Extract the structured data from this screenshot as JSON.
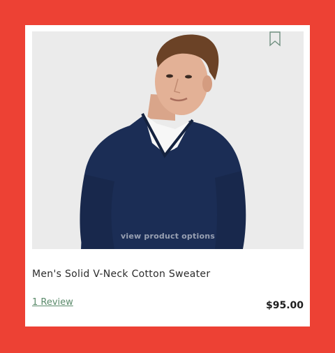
{
  "product": {
    "title": "Men's Solid V-Neck Cotton Sweater",
    "price": "$95.00",
    "review_link": "1 Review",
    "overlay_text": "view product options"
  },
  "icons": {
    "bookmark": "bookmark-icon"
  },
  "colors": {
    "page_background": "#ed4134",
    "card_background": "#ffffff",
    "image_background": "#ebebeb",
    "sweater": "#1b2d55",
    "review_link": "#5a8a6a",
    "bookmark_outline": "#6f8f7f"
  }
}
